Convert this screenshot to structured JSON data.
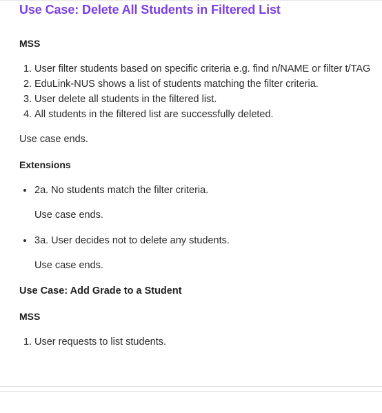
{
  "section1": {
    "title": "Use Case: Delete All Students in Filtered List",
    "mss_heading": "MSS",
    "mss_steps": [
      {
        "num": "1.",
        "text": "User filter students based on specific criteria e.g. find n/NAME or filter t/TAG"
      },
      {
        "num": "2.",
        "text": "EduLink-NUS shows a list of students matching the filter criteria."
      },
      {
        "num": "3.",
        "text": "User delete all students in the filtered list."
      },
      {
        "num": "4.",
        "text": "All students in the filtered list are successfully deleted."
      }
    ],
    "mss_end": "Use case ends.",
    "extensions_heading": "Extensions",
    "extensions": [
      {
        "text": "2a. No students match the filter criteria.",
        "end": "Use case ends."
      },
      {
        "text": "3a. User decides not to delete any students.",
        "end": "Use case ends."
      }
    ]
  },
  "section2": {
    "title": "Use Case: Add Grade to a Student",
    "mss_heading": "MSS",
    "mss_steps": [
      {
        "num": "1.",
        "text": "User requests to list students."
      }
    ]
  }
}
